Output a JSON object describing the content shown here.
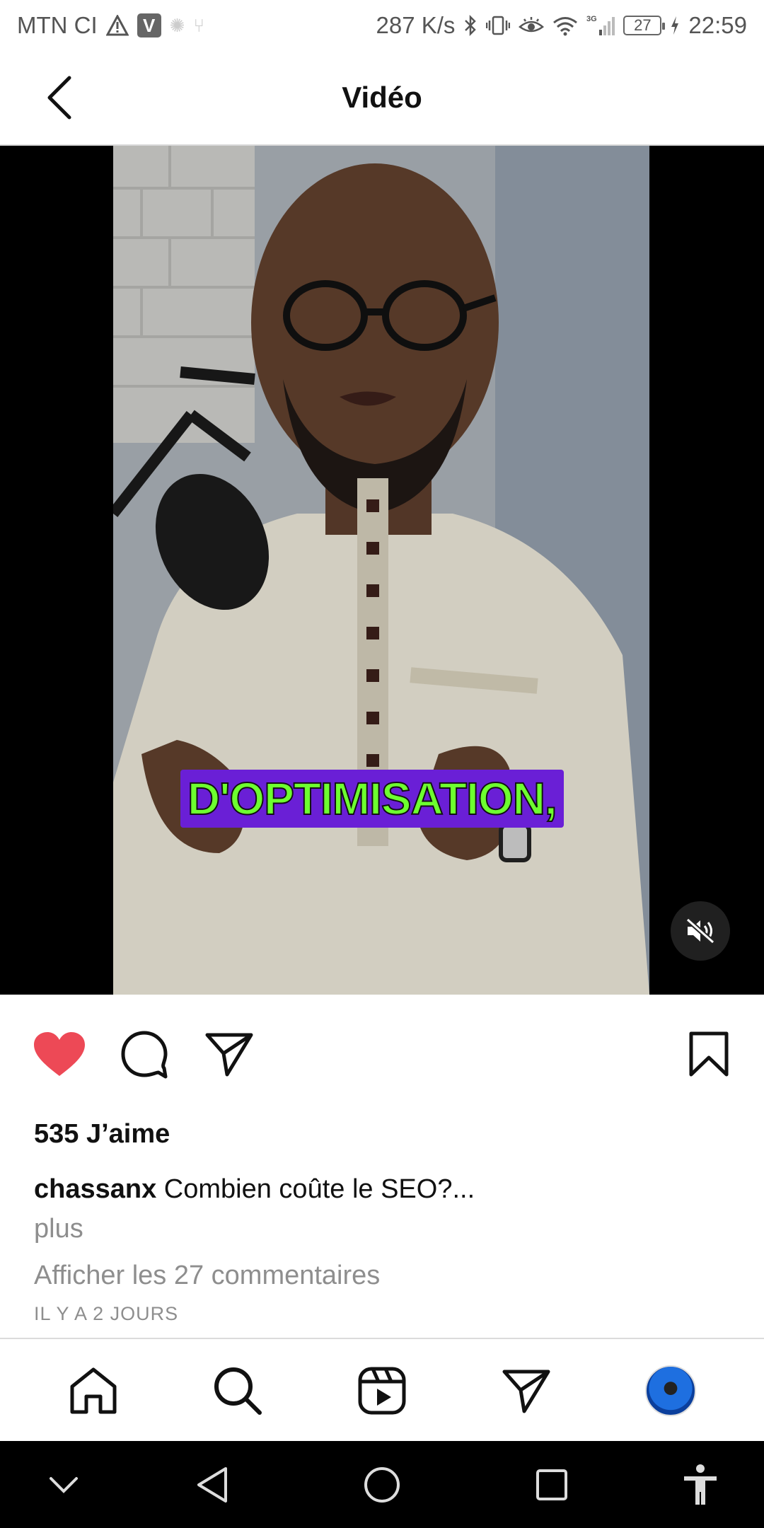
{
  "status_bar": {
    "carrier": "MTN CI",
    "speed": "287 K/s",
    "network": "3G",
    "battery": "27",
    "time": "22:59"
  },
  "header": {
    "title": "Vidéo"
  },
  "video": {
    "caption_text": "D'OPTIMISATION,",
    "muted": true
  },
  "post": {
    "likes": "535 J’aime",
    "username": "chassanx",
    "caption": "Combien coûte le SEO?...",
    "more_label": "plus",
    "comments_link": "Afficher les 27 commentaires",
    "timestamp": "IL Y A 2 JOURS",
    "liked": true
  },
  "icons": {
    "like": "heart-icon",
    "comment": "comment-icon",
    "share": "send-icon",
    "save": "bookmark-icon"
  },
  "bottom_nav": [
    "home-icon",
    "search-icon",
    "reels-icon",
    "direct-icon",
    "profile-avatar"
  ],
  "colors": {
    "like_red": "#ed4956",
    "caption_bg": "#6a1fd6",
    "caption_text": "#6dff2f"
  }
}
